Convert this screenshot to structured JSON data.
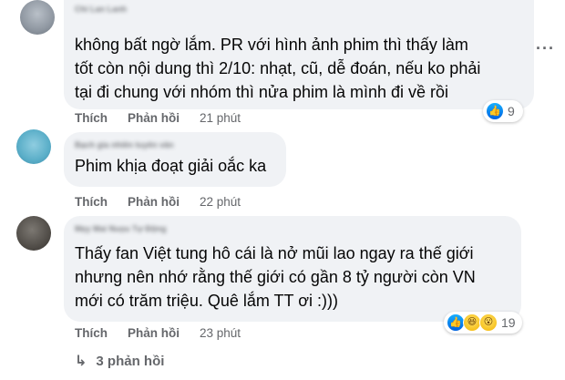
{
  "comments": [
    {
      "author": "Chi Lan Lanh",
      "text": "không bất ngờ lắm. PR với hình ảnh phim thì thấy làm\ntốt còn nội dung thì 2/10: nhạt, cũ, dễ đoán, nếu ko phải\ntại đi chung với nhóm thì nửa phim là mình đi về rồi",
      "like_label": "Thích",
      "reply_label": "Phản hồi",
      "time": "21 phút",
      "reactions": [
        "like-icon"
      ],
      "reaction_count": "9"
    },
    {
      "author": "Bạch gia nhiên tuyên vân",
      "text": "Phim khịa đoạt giải oắc ka",
      "like_label": "Thích",
      "reply_label": "Phản hồi",
      "time": "22 phút"
    },
    {
      "author": "Mẹy Mai Nuọu Tự Động",
      "text": "Thấy fan Việt tung hô cái là nở mũi lao ngay ra thế giới\nnhưng nên nhớ rằng thế giới có gần 8 tỷ người còn VN\nmới có trăm triệu. Quê lắm TT ơi :)))",
      "like_label": "Thích",
      "reply_label": "Phản hồi",
      "time": "23 phút",
      "reactions": [
        "like-icon",
        "haha-icon",
        "wow-icon"
      ],
      "reaction_count": "19"
    }
  ],
  "replies_link": {
    "arrow": "↳",
    "label": "3 phản hồi"
  },
  "more_icon": "more-options-icon",
  "colors": {
    "bubble": "#f0f2f5",
    "meta": "#65676b",
    "like_blue": "#0062df"
  }
}
